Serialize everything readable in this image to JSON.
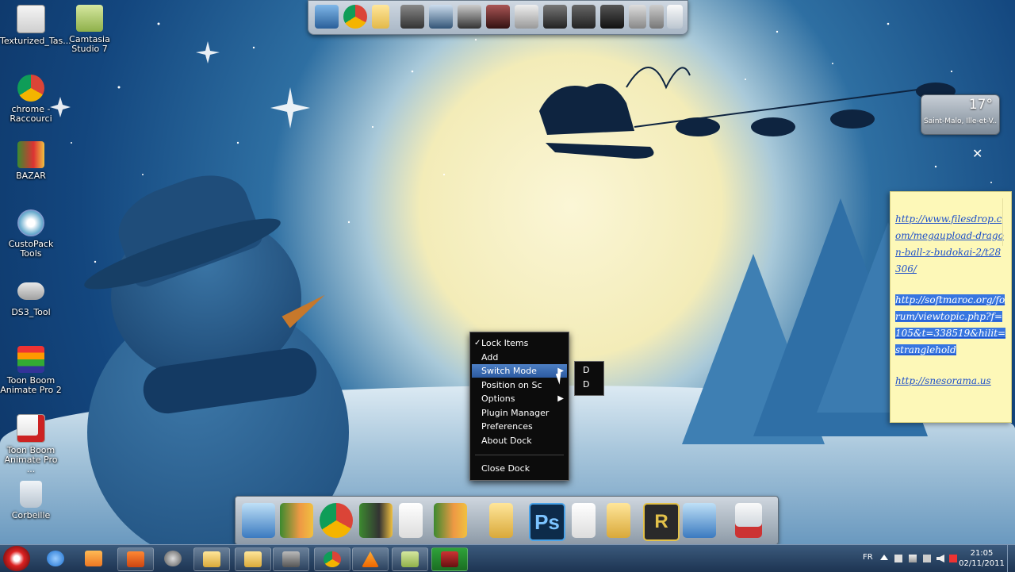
{
  "desktop_icons": [
    {
      "label": "Texturized_Tas..."
    },
    {
      "label": "Camtasia Studio 7"
    },
    {
      "label": "chrome - Raccourci"
    },
    {
      "label": "BAZAR"
    },
    {
      "label": "CustoPack Tools"
    },
    {
      "label": "DS3_Tool"
    },
    {
      "label": "Toon Boom Animate Pro 2"
    },
    {
      "label": "Toon Boom Animate Pro ..."
    },
    {
      "label": "Corbeille"
    }
  ],
  "weather": {
    "temperature": "17°",
    "location": "Saint-Malo, Ille-et-V..."
  },
  "sticky_note": {
    "link1": "http://www.filesdrop.com/megaupload-dragon-ball-z-budokai-2/t28306/",
    "link2": "http://softmaroc.org/forum/viewtopic.php?f=105&t=338519&hilit=stranglehold",
    "link3": "http://snesorama.us"
  },
  "context_menu": {
    "items": [
      "Lock Items",
      "Add",
      "Switch Mode",
      "Position on Sc",
      "Options",
      "Plugin Manager",
      "Preferences",
      "About Dock",
      "Close Dock"
    ],
    "checked_item": "Lock Items",
    "selected_item": "Switch Mode"
  },
  "submenu": {
    "items": [
      "D",
      "D"
    ]
  },
  "taskbar": {
    "language": "FR",
    "time": "21:05",
    "date": "02/11/2011"
  },
  "colors": {
    "menu_highlight": "#3a6db5",
    "sticky_bg": "#fdf8b8",
    "link": "#1d4fc9"
  }
}
